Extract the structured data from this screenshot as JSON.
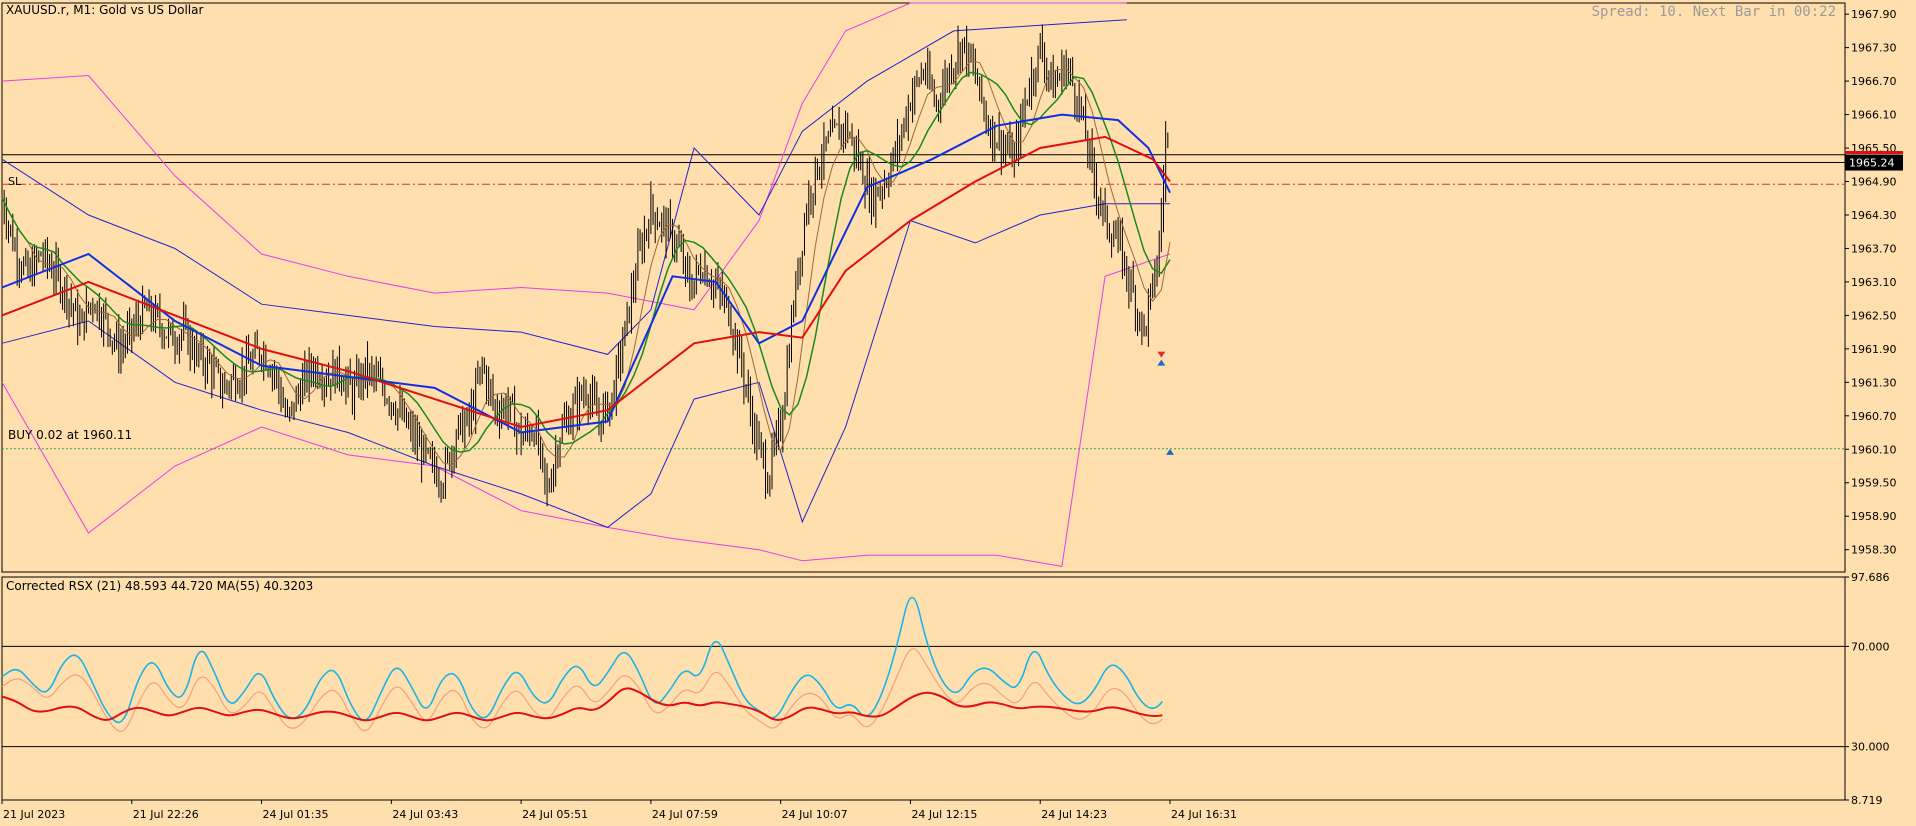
{
  "chart_title": "XAUUSD.r, M1:  Gold vs US Dollar",
  "spread_text": "Spread: 10. Next Bar in 00:22",
  "order_label": "BUY 0.02 at 1960.11",
  "sl_label": "SL",
  "current_price": "1965.24",
  "subwindow_title": "Corrected RSX (21) 48.593 44.720 MA(55) 40.3203",
  "colors": {
    "background": "#ffdfae",
    "candles": "#000000",
    "bollinger_outer": "#e83ce8",
    "bollinger_inner": "#2222cc",
    "ma_red": "#e01010",
    "ma_blue": "#1030e0",
    "ma_green": "#1a8a1a",
    "ma_brown": "#9a6a3a",
    "rsx_cyan": "#1ab4e8",
    "rsx_salmon": "#f4a080",
    "rsx_ma": "#e01010",
    "sl_line": "#e03030",
    "order_line": "#2aa84a",
    "current_price_box": "#000000",
    "arrow_up": "#1a6ac8",
    "arrow_down": "#e03030"
  },
  "chart_data": [
    {
      "type": "candlestick",
      "title": "XAUUSD.r, M1:  Gold vs US Dollar",
      "ylim": [
        1957.9,
        1968.1
      ],
      "y_ticks": [
        "1967.90",
        "1967.30",
        "1966.70",
        "1966.10",
        "1965.50",
        "1964.90",
        "1964.30",
        "1963.70",
        "1963.10",
        "1962.50",
        "1961.90",
        "1961.30",
        "1960.70",
        "1960.10",
        "1959.50",
        "1958.90",
        "1958.30"
      ],
      "x_ticks": [
        "21 Jul 2023",
        "21 Jul 22:26",
        "24 Jul 01:35",
        "24 Jul 03:43",
        "24 Jul 05:51",
        "24 Jul 07:59",
        "24 Jul 10:07",
        "24 Jul 12:15",
        "24 Jul 14:23",
        "24 Jul 16:31"
      ],
      "horizontal_lines": [
        {
          "name": "SL",
          "value": 1964.85,
          "style": "dash-dot"
        },
        {
          "name": "BUY 0.02 at 1960.11",
          "value": 1960.11,
          "style": "dotted"
        },
        {
          "name": "current-price",
          "value": 1965.24,
          "style": "solid"
        },
        {
          "name": "upper-level",
          "value": 1965.38,
          "style": "solid"
        }
      ],
      "price_path": [
        [
          0,
          1964.6
        ],
        [
          3,
          1963.7
        ],
        [
          6,
          1963.2
        ],
        [
          9,
          1963.6
        ],
        [
          12,
          1963.3
        ],
        [
          15,
          1962.9
        ],
        [
          18,
          1962.3
        ],
        [
          21,
          1962.8
        ],
        [
          24,
          1962.4
        ],
        [
          27,
          1961.9
        ],
        [
          30,
          1962.2
        ],
        [
          33,
          1962.6
        ],
        [
          36,
          1962.4
        ],
        [
          39,
          1962.1
        ],
        [
          42,
          1962.2
        ],
        [
          45,
          1961.8
        ],
        [
          48,
          1961.6
        ],
        [
          51,
          1961.2
        ],
        [
          54,
          1961.4
        ],
        [
          57,
          1961.6
        ],
        [
          60,
          1961.9
        ],
        [
          63,
          1961.5
        ],
        [
          66,
          1960.6
        ],
        [
          69,
          1961.2
        ],
        [
          72,
          1961.6
        ],
        [
          75,
          1961.4
        ],
        [
          78,
          1961.5
        ],
        [
          81,
          1961.1
        ],
        [
          84,
          1961.5
        ],
        [
          87,
          1961.3
        ],
        [
          90,
          1961.0
        ],
        [
          93,
          1960.6
        ],
        [
          96,
          1960.2
        ],
        [
          99,
          1959.8
        ],
        [
          102,
          1959.6
        ],
        [
          105,
          1960.4
        ],
        [
          108,
          1960.6
        ],
        [
          111,
          1961.6
        ],
        [
          114,
          1960.8
        ],
        [
          117,
          1960.9
        ],
        [
          120,
          1960.3
        ],
        [
          123,
          1960.5
        ],
        [
          126,
          1959.3
        ],
        [
          129,
          1960.4
        ],
        [
          132,
          1960.8
        ],
        [
          135,
          1961.2
        ],
        [
          138,
          1960.6
        ],
        [
          141,
          1961.0
        ],
        [
          144,
          1962.2
        ],
        [
          147,
          1963.5
        ],
        [
          150,
          1964.4
        ],
        [
          153,
          1964.1
        ],
        [
          156,
          1963.8
        ],
        [
          159,
          1963.0
        ],
        [
          162,
          1963.4
        ],
        [
          165,
          1963.0
        ],
        [
          168,
          1962.6
        ],
        [
          171,
          1961.6
        ],
        [
          174,
          1960.4
        ],
        [
          177,
          1959.6
        ],
        [
          180,
          1960.5
        ],
        [
          183,
          1962.7
        ],
        [
          186,
          1964.5
        ],
        [
          189,
          1965.3
        ],
        [
          192,
          1965.7
        ],
        [
          195,
          1965.9
        ],
        [
          198,
          1965.3
        ],
        [
          201,
          1964.6
        ],
        [
          204,
          1964.9
        ],
        [
          207,
          1965.5
        ],
        [
          210,
          1966.4
        ],
        [
          213,
          1966.9
        ],
        [
          216,
          1966.3
        ],
        [
          219,
          1966.9
        ],
        [
          222,
          1967.4
        ],
        [
          225,
          1966.8
        ],
        [
          228,
          1965.9
        ],
        [
          231,
          1965.6
        ],
        [
          234,
          1965.3
        ],
        [
          237,
          1966.5
        ],
        [
          240,
          1967.3
        ],
        [
          243,
          1966.6
        ],
        [
          246,
          1967.0
        ],
        [
          249,
          1966.3
        ],
        [
          252,
          1965.1
        ],
        [
          255,
          1964.2
        ],
        [
          258,
          1963.8
        ],
        [
          261,
          1963.0
        ],
        [
          264,
          1962.2
        ],
        [
          267,
          1963.4
        ],
        [
          268,
          1964.3
        ],
        [
          269,
          1965.6
        ]
      ],
      "ma_red_path": [
        [
          0,
          1962.5
        ],
        [
          20,
          1963.1
        ],
        [
          40,
          1962.5
        ],
        [
          60,
          1961.9
        ],
        [
          80,
          1961.5
        ],
        [
          100,
          1961.0
        ],
        [
          120,
          1960.5
        ],
        [
          140,
          1960.8
        ],
        [
          160,
          1962.0
        ],
        [
          175,
          1962.2
        ],
        [
          185,
          1962.1
        ],
        [
          195,
          1963.3
        ],
        [
          210,
          1964.2
        ],
        [
          225,
          1964.9
        ],
        [
          240,
          1965.5
        ],
        [
          255,
          1965.7
        ],
        [
          266,
          1965.3
        ],
        [
          270,
          1964.9
        ]
      ],
      "ma_blue_path": [
        [
          0,
          1963.0
        ],
        [
          20,
          1963.6
        ],
        [
          40,
          1962.4
        ],
        [
          60,
          1961.6
        ],
        [
          80,
          1961.4
        ],
        [
          100,
          1961.2
        ],
        [
          120,
          1960.4
        ],
        [
          140,
          1960.6
        ],
        [
          155,
          1963.2
        ],
        [
          165,
          1963.1
        ],
        [
          175,
          1962.0
        ],
        [
          185,
          1962.4
        ],
        [
          200,
          1964.8
        ],
        [
          215,
          1965.3
        ],
        [
          230,
          1965.9
        ],
        [
          245,
          1966.1
        ],
        [
          258,
          1966.0
        ],
        [
          265,
          1965.5
        ],
        [
          270,
          1964.7
        ]
      ],
      "bb_outer_upper": [
        [
          0,
          1966.7
        ],
        [
          20,
          1966.8
        ],
        [
          40,
          1965.0
        ],
        [
          60,
          1963.6
        ],
        [
          80,
          1963.2
        ],
        [
          100,
          1962.9
        ],
        [
          120,
          1963.0
        ],
        [
          140,
          1962.9
        ],
        [
          160,
          1962.6
        ],
        [
          175,
          1964.2
        ],
        [
          185,
          1966.3
        ],
        [
          195,
          1967.6
        ],
        [
          210,
          1968.1
        ],
        [
          260,
          1968.1
        ]
      ],
      "bb_outer_lower": [
        [
          0,
          1961.3
        ],
        [
          20,
          1958.6
        ],
        [
          40,
          1959.8
        ],
        [
          60,
          1960.5
        ],
        [
          80,
          1960.0
        ],
        [
          100,
          1959.8
        ],
        [
          120,
          1959.0
        ],
        [
          140,
          1958.7
        ],
        [
          155,
          1958.5
        ],
        [
          175,
          1958.3
        ],
        [
          185,
          1958.1
        ],
        [
          200,
          1958.2
        ],
        [
          230,
          1958.2
        ],
        [
          245,
          1958.0
        ],
        [
          255,
          1963.2
        ],
        [
          270,
          1963.6
        ]
      ],
      "bb_inner_upper": [
        [
          0,
          1965.3
        ],
        [
          20,
          1964.3
        ],
        [
          40,
          1963.7
        ],
        [
          60,
          1962.7
        ],
        [
          80,
          1962.5
        ],
        [
          100,
          1962.3
        ],
        [
          120,
          1962.2
        ],
        [
          140,
          1961.8
        ],
        [
          150,
          1962.6
        ],
        [
          160,
          1965.5
        ],
        [
          175,
          1964.3
        ],
        [
          185,
          1965.8
        ],
        [
          200,
          1966.7
        ],
        [
          220,
          1967.6
        ],
        [
          240,
          1967.7
        ],
        [
          260,
          1967.8
        ]
      ],
      "bb_inner_lower": [
        [
          0,
          1962.0
        ],
        [
          20,
          1962.4
        ],
        [
          40,
          1961.3
        ],
        [
          60,
          1960.8
        ],
        [
          80,
          1960.4
        ],
        [
          100,
          1959.8
        ],
        [
          120,
          1959.3
        ],
        [
          140,
          1958.7
        ],
        [
          150,
          1959.3
        ],
        [
          160,
          1961.0
        ],
        [
          175,
          1961.3
        ],
        [
          185,
          1958.8
        ],
        [
          195,
          1960.5
        ],
        [
          210,
          1964.2
        ],
        [
          225,
          1963.8
        ],
        [
          240,
          1964.3
        ],
        [
          255,
          1964.5
        ],
        [
          270,
          1964.5
        ]
      ]
    },
    {
      "type": "line",
      "title": "Corrected RSX (21) 48.593 44.720 MA(55) 40.3203",
      "ylim": [
        8.719,
        97.686
      ],
      "y_ticks": [
        "97.686",
        "70.000",
        "30.000",
        "8.719"
      ],
      "levels": [
        70.0,
        30.0
      ],
      "series": [
        {
          "name": "RSX",
          "values": [
            58,
            62,
            55,
            50,
            64,
            68,
            55,
            42,
            38,
            58,
            66,
            52,
            48,
            72,
            60,
            45,
            52,
            62,
            48,
            40,
            44,
            58,
            62,
            46,
            38,
            52,
            64,
            54,
            42,
            58,
            60,
            44,
            40,
            54,
            62,
            50,
            46,
            58,
            64,
            52,
            60,
            70,
            60,
            45,
            52,
            62,
            56,
            76,
            62,
            48,
            44,
            40,
            52,
            60,
            55,
            44,
            48,
            40,
            50,
            70,
            96,
            70,
            55,
            50,
            60,
            62,
            56,
            52,
            72,
            58,
            50,
            46,
            52,
            64,
            60,
            48,
            44,
            52
          ]
        },
        {
          "name": "RSX signal",
          "values": [
            54,
            58,
            54,
            48,
            56,
            60,
            52,
            40,
            34,
            48,
            58,
            48,
            44,
            60,
            54,
            42,
            46,
            54,
            44,
            36,
            40,
            50,
            54,
            42,
            34,
            46,
            56,
            48,
            38,
            50,
            54,
            40,
            36,
            48,
            54,
            44,
            40,
            50,
            56,
            46,
            52,
            60,
            54,
            42,
            46,
            54,
            50,
            62,
            54,
            44,
            40,
            36,
            46,
            52,
            50,
            40,
            44,
            36,
            44,
            58,
            72,
            62,
            52,
            46,
            54,
            56,
            50,
            46,
            58,
            50,
            44,
            40,
            44,
            54,
            52,
            42,
            38,
            44
          ]
        },
        {
          "name": "MA(55)",
          "values": [
            50,
            48,
            44,
            44,
            46,
            46,
            42,
            40,
            44,
            46,
            44,
            42,
            44,
            46,
            44,
            42,
            44,
            45,
            43,
            41,
            42,
            44,
            44,
            42,
            40,
            42,
            44,
            42,
            40,
            42,
            44,
            42,
            40,
            42,
            44,
            42,
            41,
            43,
            46,
            44,
            48,
            54,
            52,
            48,
            46,
            48,
            46,
            48,
            47,
            46,
            44,
            40,
            42,
            46,
            45,
            43,
            44,
            42,
            42,
            46,
            50,
            52,
            50,
            46,
            46,
            48,
            47,
            45,
            46,
            46,
            45,
            44,
            44,
            46,
            45,
            43,
            42,
            43
          ]
        }
      ]
    }
  ]
}
